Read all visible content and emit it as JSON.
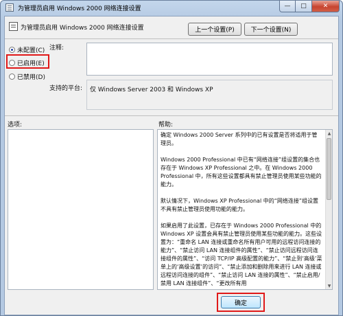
{
  "window": {
    "title": "为管理员启用 Windows 2000 网络连接设置",
    "caption_buttons": {
      "minimize": "—",
      "maximize": "□",
      "close": "✕"
    }
  },
  "header": {
    "title": "为管理员启用 Windows 2000 网络连接设置",
    "prev_button": "上一个设置(P)",
    "next_button": "下一个设置(N)"
  },
  "options": {
    "selected": "not_configured",
    "not_configured": "未配置(C)",
    "enabled": "已启用(E)",
    "disabled": "已禁用(D)"
  },
  "comment": {
    "label": "注释:",
    "value": ""
  },
  "platform": {
    "label": "支持的平台:",
    "value": "仅 Windows Server 2003 和 Windows XP"
  },
  "options_panel": {
    "label": "选项:"
  },
  "help": {
    "label": "帮助:",
    "paragraphs": [
      "确定 Windows 2000 Server 系列中的已有设置是否将适用于管理员。",
      "Windows 2000 Professional 中已有“网络连接”组设置的集合也存在于 Windows XP Professional 之中。在 Windows 2000 Professional 中，所有这些设置都具有禁止管理员使用某些功能的能力。",
      "默认情况下，Windows XP Professional 中的“网络连接”组设置不具有禁止管理员使用功能的能力。",
      "如果启用了此设置，已存在于 Windows 2000 Professional 中的 Windows XP 设置会具有禁止管理员使用某些功能的能力。这些设置为：“重命名 LAN 连接或重命名所有用户可用的远程访问连接的能力”、“禁止访问 LAN 连接组件的属性”、“禁止访问远程访问连接组件的属性”、“访问 TCP/IP 高级配置的能力”、“禁止到‘高级’菜单上的‘高级设置’的访问”、“禁止添加和删除用来进行 LAN 连接或远程访问连接的组件”、“禁止访问 LAN 连接的属性”、“禁止启用/禁用 LAN 连接组件”、“更改所有用"
    ]
  },
  "footer": {
    "ok_button": "确定"
  },
  "colors": {
    "highlight": "#e01818",
    "title_bar": "#b4c9e2",
    "dialog_bg": "#f0f0f0"
  }
}
